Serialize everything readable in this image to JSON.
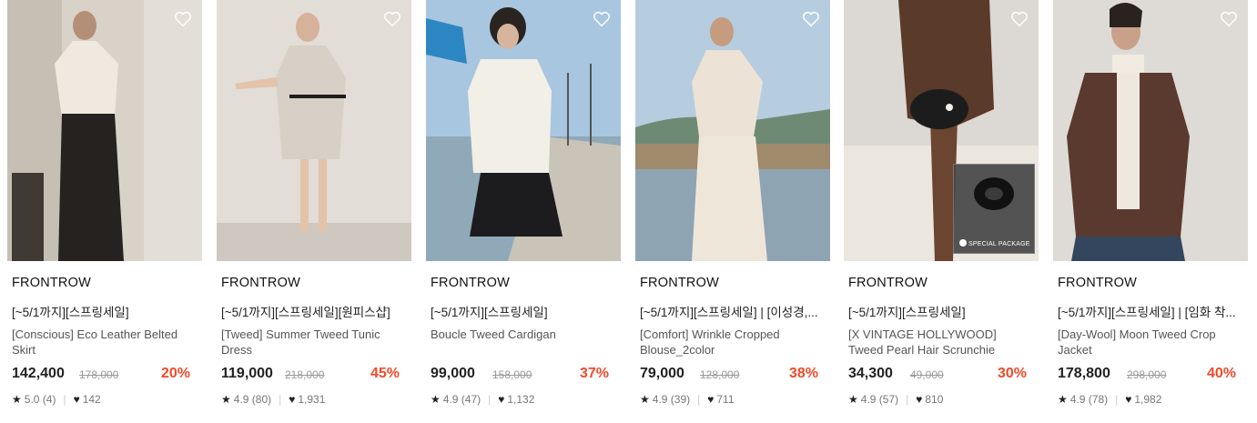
{
  "colors": {
    "discount": "#ef4b2a",
    "price": "#222222",
    "original_price": "#999999"
  },
  "icons": {
    "wishlist": "heart-outline-icon",
    "rating": "star-icon",
    "likes": "heart-filled-icon"
  },
  "products": [
    {
      "brand": "FRONTROW",
      "promo": "[~5/1까지][스프링세일]",
      "name": "[Conscious] Eco Leather Belted Skirt",
      "price": "142,400",
      "original_price": "178,000",
      "discount": "20%",
      "rating": "5.0 (4)",
      "likes": "142"
    },
    {
      "brand": "FRONTROW",
      "promo": "[~5/1까지][스프링세일][원피스샵]",
      "name": "[Tweed] Summer Tweed Tunic Dress",
      "price": "119,000",
      "original_price": "218,000",
      "discount": "45%",
      "rating": "4.9 (80)",
      "likes": "1,931"
    },
    {
      "brand": "FRONTROW",
      "promo": "[~5/1까지][스프링세일]",
      "name": "Boucle Tweed Cardigan",
      "price": "99,000",
      "original_price": "158,000",
      "discount": "37%",
      "rating": "4.9 (47)",
      "likes": "1,132"
    },
    {
      "brand": "FRONTROW",
      "promo": "[~5/1까지][스프링세일] | [이성경,...",
      "name": "[Comfort] Wrinkle Cropped Blouse_2color",
      "price": "79,000",
      "original_price": "128,000",
      "discount": "38%",
      "rating": "4.9 (39)",
      "likes": "711"
    },
    {
      "brand": "FRONTROW",
      "promo": "[~5/1까지][스프링세일]",
      "name": "[X VINTAGE HOLLYWOOD] Tweed Pearl Hair Scrunchie",
      "price": "34,300",
      "original_price": "49,000",
      "discount": "30%",
      "rating": "4.9 (57)",
      "likes": "810",
      "badge": "SPECIAL PACKAGE"
    },
    {
      "brand": "FRONTROW",
      "promo": "[~5/1까지][스프링세일] | [임화 착...",
      "name": "[Day-Wool] Moon Tweed Crop Jacket",
      "price": "178,800",
      "original_price": "298,000",
      "discount": "40%",
      "rating": "4.9 (78)",
      "likes": "1,982"
    }
  ]
}
